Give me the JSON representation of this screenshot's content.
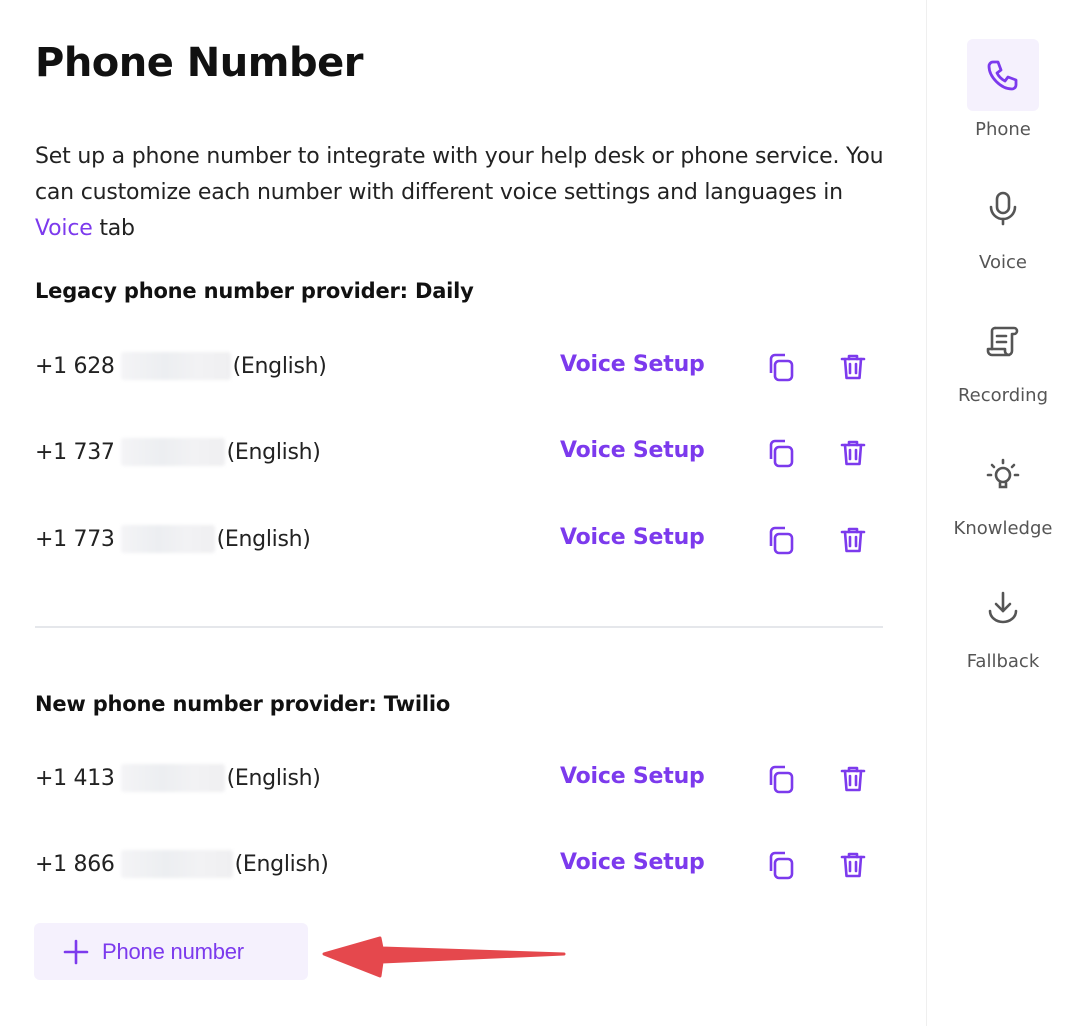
{
  "page": {
    "title": "Phone Number",
    "description_before": "Set up a phone number to integrate with your help desk or phone service. You can customize each number with different voice settings and languages in ",
    "description_link": "Voice",
    "description_after": " tab"
  },
  "legacy": {
    "title": "Legacy phone number provider: Daily",
    "rows": [
      {
        "prefix": "+1 628",
        "language": "(English)",
        "action": "Voice Setup"
      },
      {
        "prefix": "+1 737",
        "language": "(English)",
        "action": "Voice Setup"
      },
      {
        "prefix": "+1 773",
        "language": "(English)",
        "action": "Voice Setup"
      }
    ]
  },
  "twilio": {
    "title": "New phone number provider: Twilio",
    "rows": [
      {
        "prefix": "+1 413",
        "language": "(English)",
        "action": "Voice Setup"
      },
      {
        "prefix": "+1 866",
        "language": "(English)",
        "action": "Voice Setup"
      }
    ]
  },
  "add_button": {
    "label": "Phone number",
    "icon": "plus-icon"
  },
  "sidebar": {
    "items": [
      {
        "label": "Phone",
        "icon": "phone-icon",
        "active": true
      },
      {
        "label": "Voice",
        "icon": "microphone-icon",
        "active": false
      },
      {
        "label": "Recording",
        "icon": "scroll-icon",
        "active": false
      },
      {
        "label": "Knowledge",
        "icon": "lightbulb-icon",
        "active": false
      },
      {
        "label": "Fallback",
        "icon": "download-icon",
        "active": false
      }
    ]
  },
  "colors": {
    "accent": "#7c3aed",
    "accent_bg": "#f5f1fd",
    "annotation_arrow": "#e5484d"
  }
}
